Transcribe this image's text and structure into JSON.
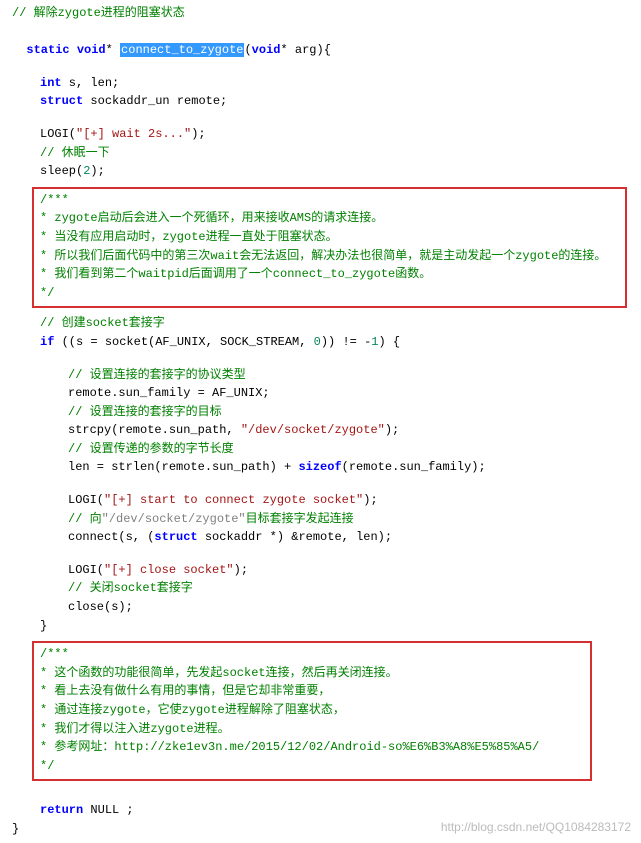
{
  "line1": "// 解除zygote进程的阻塞状态",
  "sig": {
    "static": "static",
    "void": "void",
    "star": "*",
    "fn": "connect_to_zygote",
    "open": "(",
    "void2": "void",
    "star2": "*",
    "arg": " arg){"
  },
  "decl1": {
    "a": "int",
    "b": " s, len;"
  },
  "decl2": {
    "a": "struct",
    "b": " sockaddr_un remote;"
  },
  "logi1": {
    "a": "LOGI(",
    "b": "\"[+] wait 2s...\"",
    "c": ");"
  },
  "sleepc": "// 休眠一下",
  "sleep": {
    "a": "sleep(",
    "b": "2",
    "c": ");"
  },
  "box1": {
    "l1": "/***",
    "l2": " * zygote启动后会进入一个死循环，用来接收AMS的请求连接。",
    "l3": " * 当没有应用启动时，zygote进程一直处于阻塞状态。",
    "l4": " * 所以我们后面代码中的第三次wait会无法返回，解决办法也很简单，就是主动发起一个zygote的连接。",
    "l5": " * 我们看到第二个waitpid后面调用了一个connect_to_zygote函数。",
    "l6": " */"
  },
  "sockc": "// 创建socket套接字",
  "ifline": {
    "a": "if",
    "b": " ((s = socket(AF_UNIX, SOCK_STREAM, ",
    "c": "0",
    "d": ")) != -",
    "e": "1",
    "f": ") {"
  },
  "c1": "// 设置连接的套接字的协议类型",
  "r1": "remote.sun_family = AF_UNIX;",
  "c2": "// 设置连接的套接字的目标",
  "strcpy": {
    "a": "strcpy(remote.sun_path, ",
    "b": "\"/dev/socket/zygote\"",
    "c": ");"
  },
  "c3": "// 设置传递的参数的字节长度",
  "len": {
    "a": "len = strlen(remote.sun_path) + ",
    "b": "sizeof",
    "c": "(remote.sun_family);"
  },
  "logi2": {
    "a": "LOGI(",
    "b": "\"[+] start to connect zygote socket\"",
    "c": ");"
  },
  "c4a": "// 向",
  "c4b": "\"/dev/socket/zygote\"",
  "c4c": "目标套接字发起连接",
  "connect": {
    "a": "connect(s, (",
    "b": "struct",
    "c": " sockaddr *) &remote, len);"
  },
  "logi3": {
    "a": "LOGI(",
    "b": "\"[+] close socket\"",
    "c": ");"
  },
  "c5": "// 关闭socket套接字",
  "close": "close(s);",
  "brace1": "}",
  "box2": {
    "l1": "/***",
    "l2": " * 这个函数的功能很简单，先发起socket连接，然后再关闭连接。",
    "l3": " * 看上去没有做什么有用的事情，但是它却非常重要，",
    "l4": " * 通过连接zygote，它使zygote进程解除了阻塞状态，",
    "l5": " * 我们才得以注入进zygote进程。",
    "l6": " * 参考网址：http://zke1ev3n.me/2015/12/02/Android-so%E6%B3%A8%E5%85%A5/",
    "l7": " */"
  },
  "ret": {
    "a": "return",
    "b": " NULL ;"
  },
  "brace2": "}",
  "watermark": "http://blog.csdn.net/QQ1084283172"
}
